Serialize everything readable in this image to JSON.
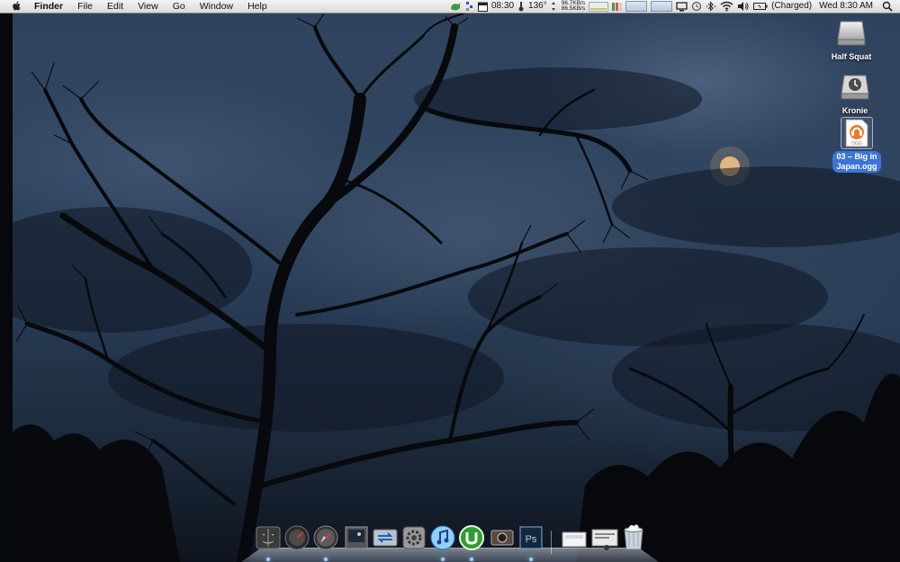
{
  "menubar": {
    "app_name": "Finder",
    "menus": [
      "File",
      "Edit",
      "View",
      "Go",
      "Window",
      "Help"
    ],
    "status": {
      "clock_short": "08:30",
      "temperature": "136°",
      "net_up": "96.7KB/s",
      "net_down": "86.5KB/s",
      "battery_status": "(Charged)",
      "datetime": "Wed 8:30 AM"
    },
    "icons": [
      "growl-icon",
      "activity-icon",
      "calendar-icon",
      "temperature-icon",
      "network-speed-icon",
      "memory-meter-icon",
      "cpu-bars-icon",
      "cpu-graph-icon",
      "disk-graph-icon",
      "display-icon",
      "time-machine-icon",
      "bluetooth-icon",
      "wifi-icon",
      "volume-icon",
      "battery-icon",
      "spotlight-icon"
    ]
  },
  "desktop": {
    "icons": [
      {
        "label": "Half Squat",
        "kind": "hard-drive-icon"
      },
      {
        "label": "Kronie",
        "kind": "time-machine-drive-icon"
      },
      {
        "label": "03 - Big in Japan.ogg",
        "label_lines": [
          "03 – Big in",
          "Japan.ogg"
        ],
        "kind": "ogg-file-icon",
        "selected": true
      }
    ]
  },
  "dock": {
    "items": [
      {
        "name": "finder",
        "running": true
      },
      {
        "name": "dashboard",
        "running": false
      },
      {
        "name": "safari",
        "running": true
      },
      {
        "name": "preview",
        "running": false
      },
      {
        "name": "migration",
        "running": false
      },
      {
        "name": "system-preferences",
        "running": false
      },
      {
        "name": "itunes",
        "running": true
      },
      {
        "name": "utorrent",
        "running": true
      },
      {
        "name": "image-app",
        "running": false
      },
      {
        "name": "photoshop",
        "running": true
      },
      {
        "name": "downloads-stack",
        "running": false
      },
      {
        "name": "documents-stack",
        "running": false
      },
      {
        "name": "trash",
        "running": false
      }
    ]
  },
  "colors": {
    "selection": "#3b75d6",
    "dock_indicator": "#9cd4ff"
  }
}
